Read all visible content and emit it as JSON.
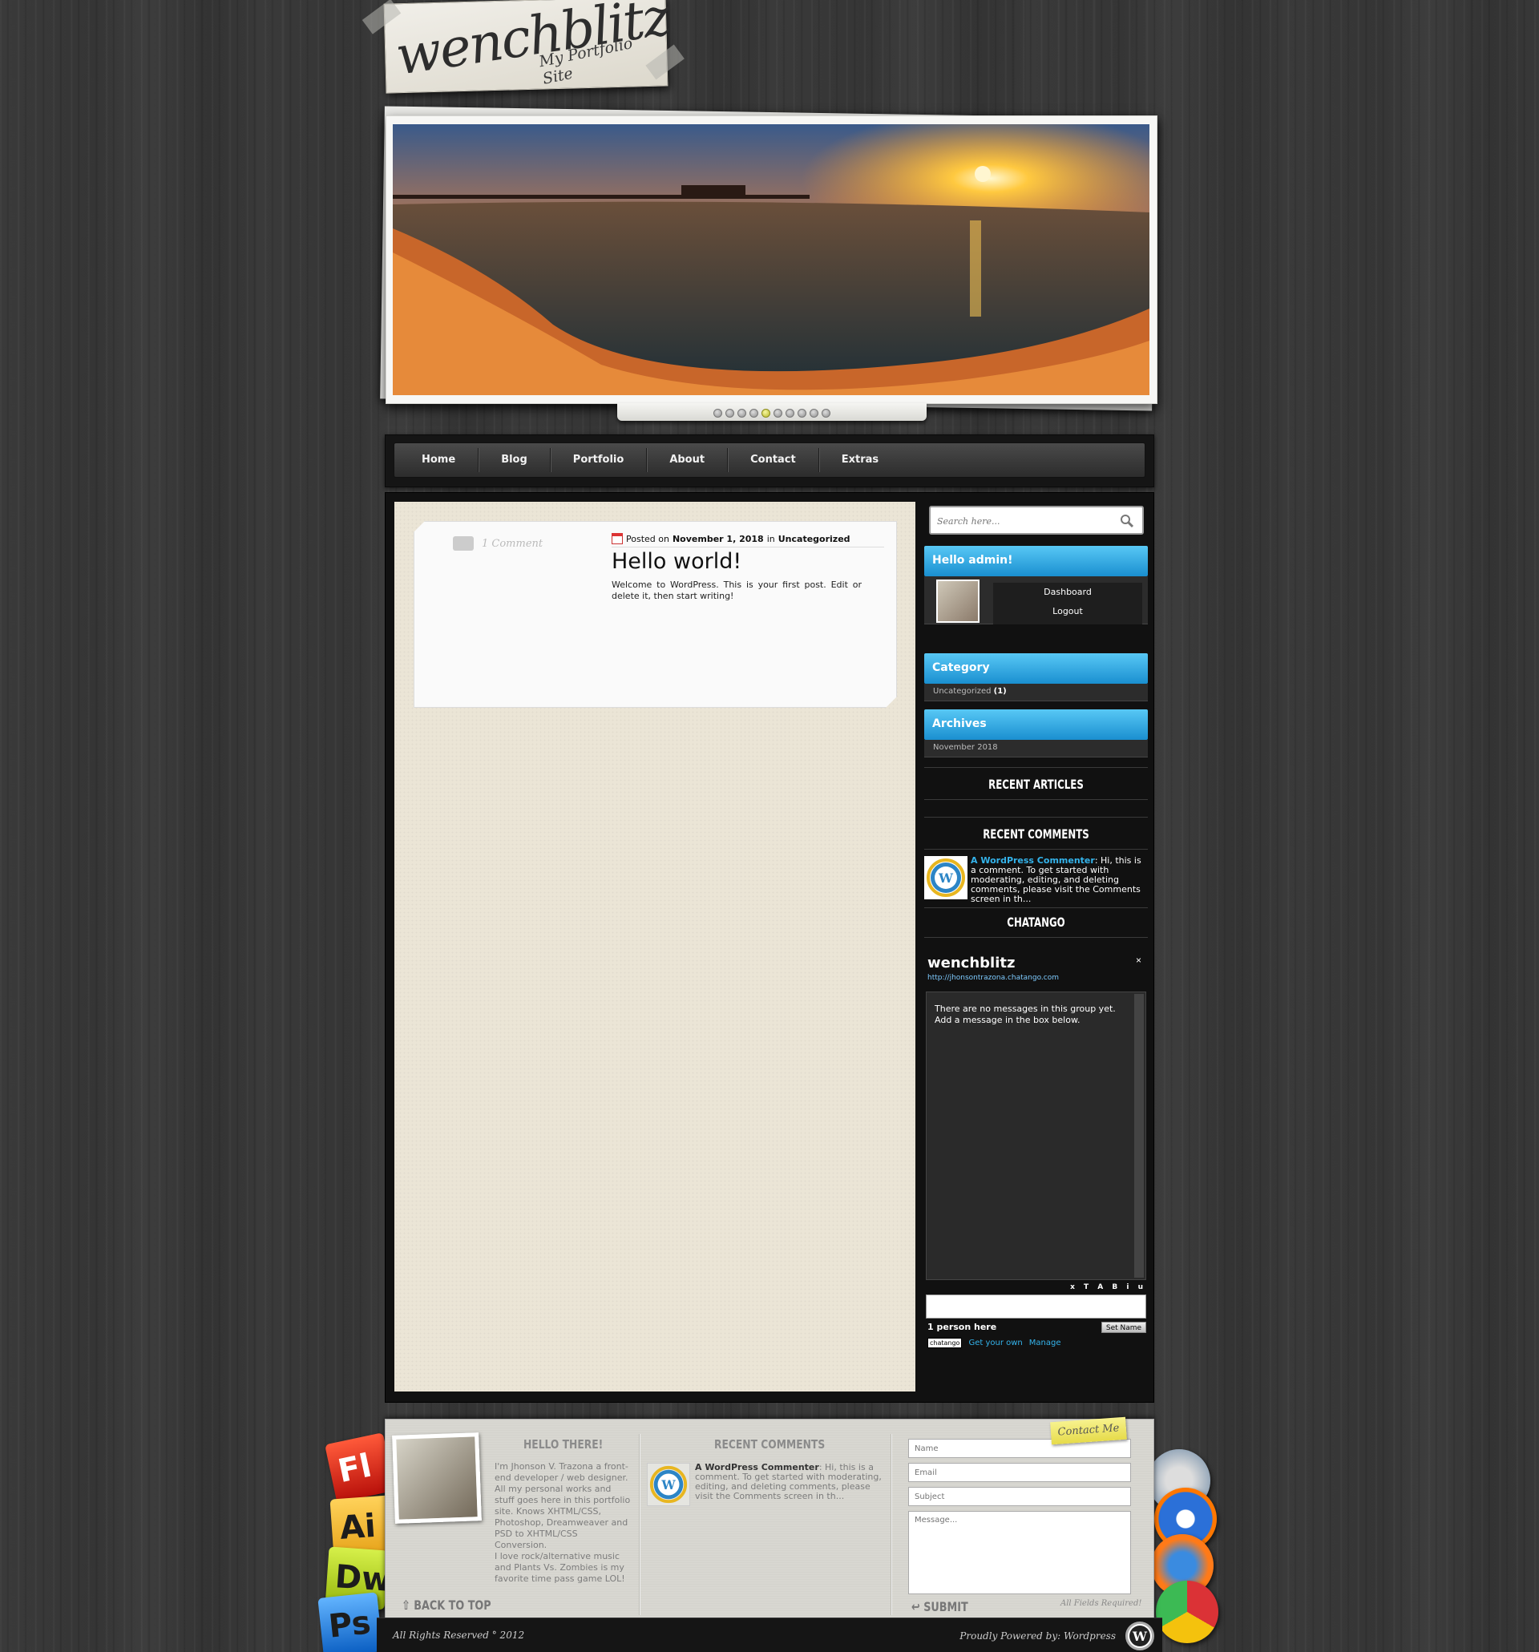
{
  "logo": {
    "title": "wenchblitz",
    "subtitle": "My Portfolio Site"
  },
  "slider": {
    "slide_count": 10,
    "active_slide": 5
  },
  "nav": {
    "items": [
      "Home",
      "Blog",
      "Portfolio",
      "About",
      "Contact",
      "Extras"
    ]
  },
  "post": {
    "comment_count": "1 Comment",
    "posted_on_label": "Posted on",
    "date": "November 1, 2018",
    "in_label": "in",
    "category": "Uncategorized",
    "title": "Hello world!",
    "excerpt": "Welcome to WordPress. This is your first post. Edit or delete it, then start writing!"
  },
  "sidebar": {
    "search_placeholder": "Search here...",
    "hello": {
      "title": "Hello admin!",
      "dashboard": "Dashboard",
      "logout": "Logout"
    },
    "category": {
      "title": "Category",
      "item": "Uncategorized",
      "count": "(1)"
    },
    "archives": {
      "title": "Archives",
      "item": "November 2018"
    },
    "recent_articles_title": "RECENT ARTICLES",
    "recent_comments_title": "RECENT COMMENTS",
    "recent_comment": {
      "author": "A WordPress Commenter",
      "text": ": Hi, this is a comment. To get started with moderating, editing, and deleting comments, please visit the Comments screen in th..."
    },
    "chatango_title": "CHATANGO",
    "chat": {
      "group": "wenchblitz",
      "url": "http://jhonsontrazona.chatango.com",
      "close": "×",
      "message": "There are no messages in this group yet. Add a message in the  box below.",
      "tools": "x T A B i u",
      "people": "1 person here",
      "set_name": "Set Name",
      "logo": "chatango",
      "get_own": "Get your own",
      "manage": "Manage"
    }
  },
  "footer": {
    "hello_title": "HELLO THERE!",
    "bio": "I'm Jhonson V. Trazona a front-end developer / web designer. All my personal works and stuff goes here in this portfolio site. Knows XHTML/CSS, Photoshop, Dreamweaver and PSD to XHTML/CSS Conversion.",
    "bio2": "I love rock/alternative music and Plants Vs. Zombies is my favorite time pass game LOL!",
    "back_top": "BACK TO TOP",
    "recent_comments_title": "RECENT COMMENTS",
    "recent_comment_author": "A WordPress Commenter",
    "recent_comment_text": ": Hi, this is a comment. To get started with moderating, editing, and deleting comments, please visit the Comments screen in th...",
    "contact_tab": "Contact Me",
    "form": {
      "name": "Name",
      "email": "Email",
      "subject": "Subject",
      "message": "Message...",
      "submit": "SUBMIT",
      "required": "All Fields Required!"
    },
    "copyright": "All Rights Reserved ° 2012",
    "powered": "Proudly Powered by: Wordpress",
    "app_icons": {
      "fl": "Fl",
      "ai": "Ai",
      "dw": "Dw",
      "ps": "Ps"
    }
  },
  "colors": {
    "accent_blue": "#2aa2e2",
    "paper": "#ebe5d6",
    "dark": "#111111"
  }
}
